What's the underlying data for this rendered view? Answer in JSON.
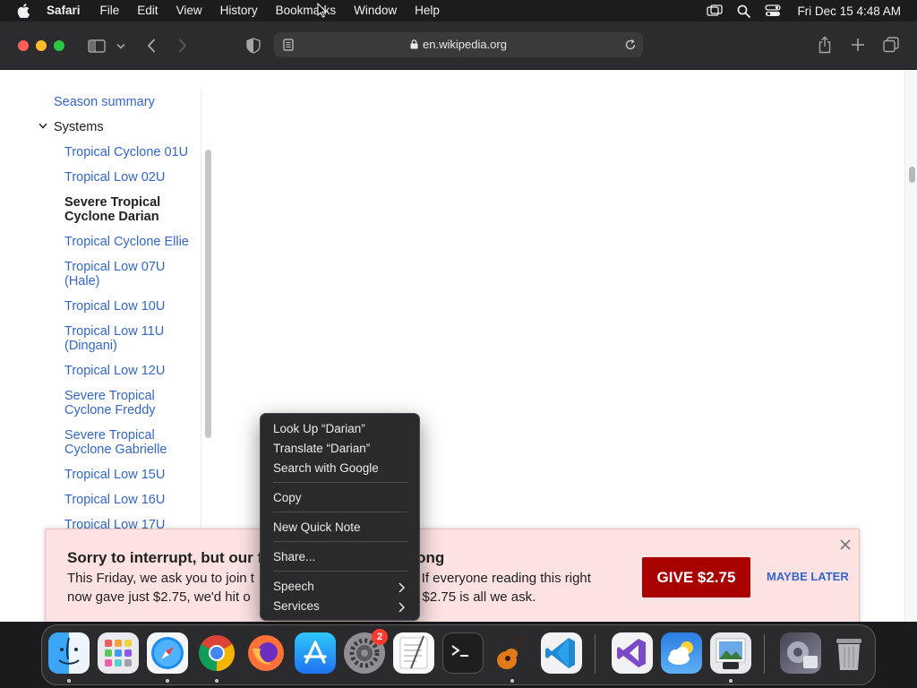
{
  "menubar": {
    "app_name": "Safari",
    "items": [
      "File",
      "Edit",
      "View",
      "History",
      "Bookmarks",
      "Window",
      "Help"
    ],
    "clock": "Fri Dec 15  4:48 AM"
  },
  "toolbar": {
    "url": "en.wikipedia.org"
  },
  "toc": {
    "items": [
      "Season summary",
      "Systems",
      "Tropical Cyclone 01U",
      "Tropical Low 02U",
      "Severe Tropical Cyclone Darian",
      "Tropical Cyclone Ellie",
      "Tropical Low 07U (Hale)",
      "Tropical Low 10U",
      "Tropical Low 11U (Dingani)",
      "Tropical Low 12U",
      "Severe Tropical Cyclone Freddy",
      "Severe Tropical Cyclone Gabrielle",
      "Tropical Low 15U",
      "Tropical Low 16U",
      "Tropical Low 17U"
    ]
  },
  "banner": {
    "headline": "Sorry to interrupt, but our f",
    "headline_tail": "ong",
    "body_line1_start": "This Friday, we ask you to join t",
    "body_line1_end": "e. If everyone reading this right",
    "body_line2_start": "now gave just $2.75, we'd hit o",
    "body_line2_end": "s. $2.75 is all we ask.",
    "give_label": "GIVE $2.75",
    "later_label": "MAYBE LATER"
  },
  "context_menu": {
    "items": [
      "Look Up “Darian”",
      "Translate “Darian”",
      "Search with Google",
      "Copy",
      "New Quick Note",
      "Share...",
      "Speech",
      "Services"
    ]
  },
  "dock": {
    "settings_badge": "2",
    "apps": [
      "finder",
      "launchpad",
      "safari",
      "chrome",
      "firefox",
      "app-store",
      "system-settings",
      "textedit",
      "terminal",
      "garageband",
      "vscode",
      "visual-studio",
      "weather",
      "preview",
      "downloads",
      "trash"
    ]
  },
  "colors": {
    "link": "#3366cc",
    "banner_bg": "#fde2e2",
    "give_button": "#a90000",
    "menu_bg": "#2a2a2c"
  }
}
